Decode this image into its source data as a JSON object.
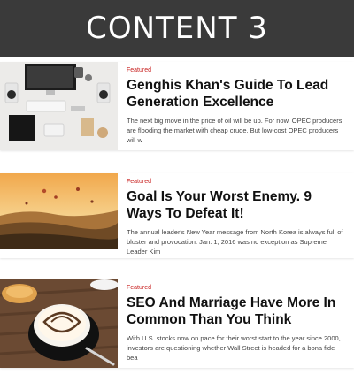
{
  "header": {
    "title": "CONTENT 3"
  },
  "posts": [
    {
      "tag": "Featured",
      "title": "Genghis Khan's Guide To Lead Generation Excellence",
      "excerpt": "The next big move in the price of oil will be up. For now, OPEC producers are flooding the market with cheap crude. But low-cost OPEC producers will w"
    },
    {
      "tag": "Featured",
      "title": "Goal Is Your Worst Enemy. 9 Ways To Defeat It!",
      "excerpt": "The annual leader's New Year message from North Korea is always full of bluster and provocation. Jan. 1, 2016 was no exception as Supreme Leader Kim"
    },
    {
      "tag": "Featured",
      "title": "SEO And Marriage Have More In Common Than You Think",
      "excerpt": "With U.S. stocks now on pace for their worst start to the year since 2000, investors are questioning whether Wall Street is headed for a bona fide bea"
    }
  ]
}
